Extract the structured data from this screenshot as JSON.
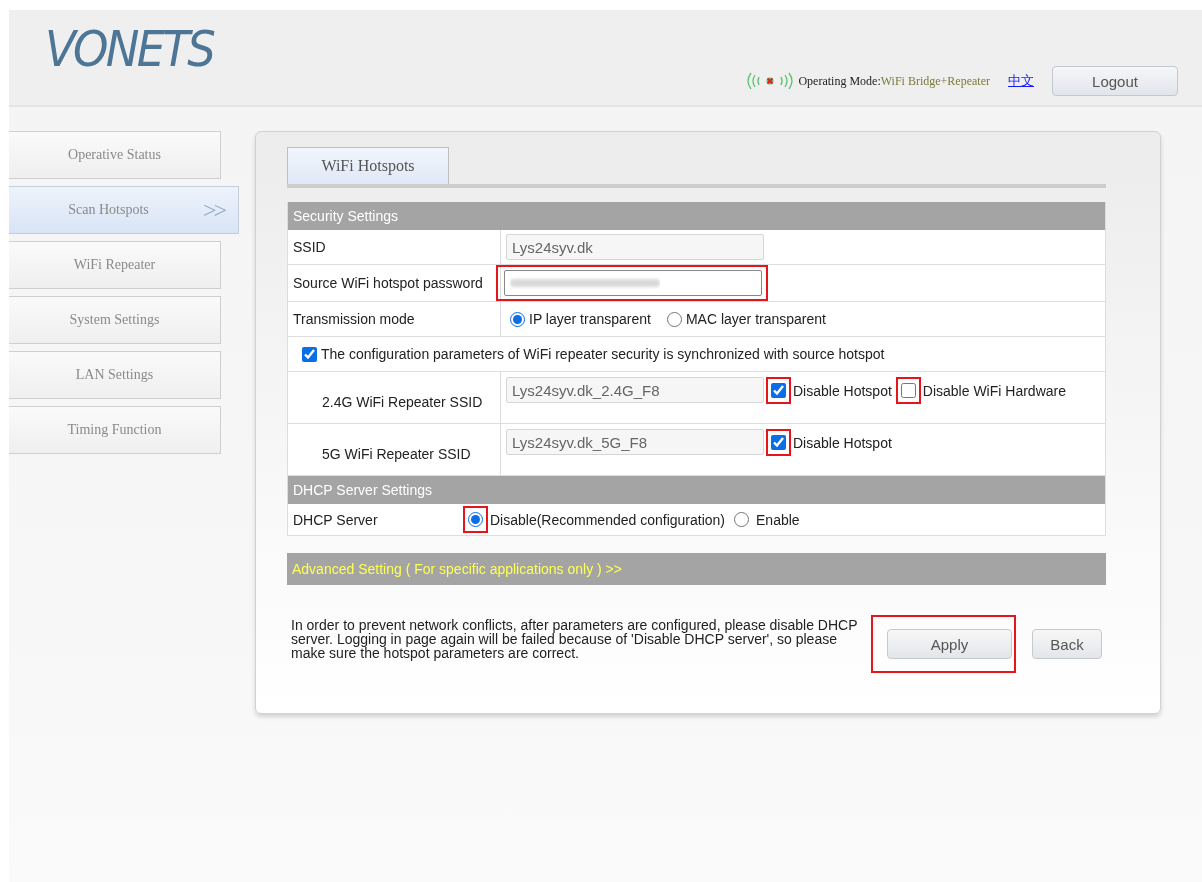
{
  "header": {
    "logo": "VONETS",
    "mode_label": "Operating Mode:",
    "mode_value": "WiFi Bridge+Repeater",
    "language_link": "中文",
    "logout": "Logout"
  },
  "sidebar": {
    "items": [
      {
        "label": "Operative Status",
        "selected": false
      },
      {
        "label": "Scan Hotspots",
        "selected": true,
        "marker": ">>"
      },
      {
        "label": "WiFi Repeater",
        "selected": false
      },
      {
        "label": "System Settings",
        "selected": false
      },
      {
        "label": "LAN Settings",
        "selected": false
      },
      {
        "label": "Timing Function",
        "selected": false
      }
    ]
  },
  "tabs": [
    {
      "label": "WiFi Hotspots",
      "selected": true
    }
  ],
  "security": {
    "title": "Security Settings",
    "ssid": {
      "label": "SSID",
      "value": "Lys24syv.dk"
    },
    "password": {
      "label": "Source WiFi hotspot password",
      "highlighted": true
    },
    "transmission": {
      "label": "Transmission mode",
      "options": [
        {
          "label": "IP layer transparent",
          "selected": true
        },
        {
          "label": "MAC layer transparent",
          "selected": false
        }
      ]
    },
    "sync": {
      "label": "The configuration parameters of WiFi repeater security is synchronized with source hotspot",
      "checked": true
    },
    "repeaters": [
      {
        "label": "2.4G WiFi Repeater SSID",
        "value": "Lys24syv.dk_2.4G_F8",
        "options": [
          {
            "label": "Disable Hotspot",
            "checked": true,
            "highlighted": true
          },
          {
            "label": "Disable WiFi Hardware",
            "checked": false,
            "highlighted": true
          }
        ]
      },
      {
        "label": "5G WiFi Repeater SSID",
        "value": "Lys24syv.dk_5G_F8",
        "options": [
          {
            "label": "Disable Hotspot",
            "checked": true,
            "highlighted": true
          }
        ]
      }
    ]
  },
  "dhcp": {
    "title": "DHCP Server Settings",
    "label": "DHCP Server",
    "options": [
      {
        "label": "Disable(Recommended configuration)",
        "selected": true,
        "highlighted": true
      },
      {
        "label": "Enable",
        "selected": false,
        "highlighted": false
      }
    ]
  },
  "advanced": "Advanced Setting ( For specific applications only ) >>",
  "note": "In order to prevent network conflicts, after parameters are configured, please disable DHCP server. Logging in page again will be failed because of 'Disable DHCP server', so please make sure the hotspot parameters are correct.",
  "buttons": [
    {
      "label": "Apply",
      "highlighted": true
    },
    {
      "label": "Back",
      "highlighted": false
    }
  ]
}
